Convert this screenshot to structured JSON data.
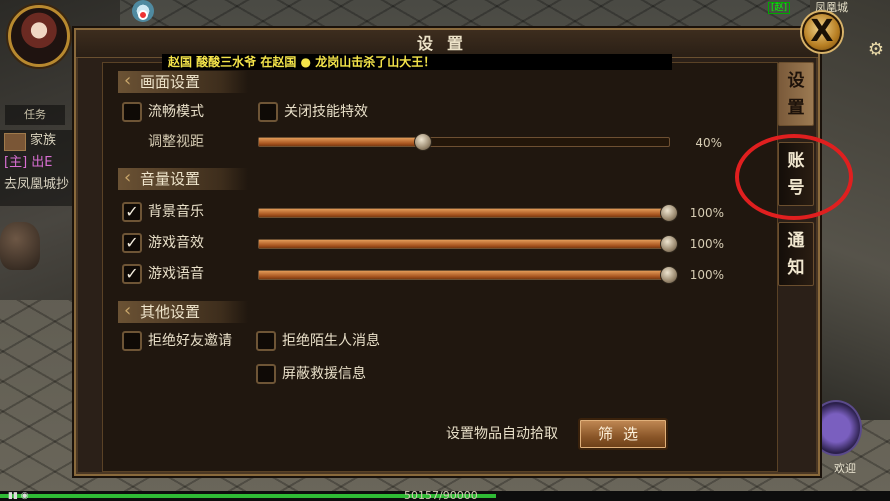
{
  "hud": {
    "task_tab": "任务",
    "chat": {
      "family_label": "家族",
      "main_line": "[主] 出E",
      "system_line": "去凤凰城抄"
    },
    "minimap": {
      "zone_flag": "[赵]",
      "location": "凤凰城"
    },
    "skill_label": "欢迎",
    "exp_text": "50157/90000",
    "exp_progress": 0.557
  },
  "dialog": {
    "title": "设置",
    "marquee": {
      "prefix": "赵国  酸酸三水爷  在赵国",
      "suffix": "龙岗山击杀了山大王！"
    },
    "sections": {
      "graphics": {
        "header": "画面设置",
        "smooth_mode": {
          "label": "流畅模式",
          "checked": false
        },
        "disable_skill_fx": {
          "label": "关闭技能特效",
          "checked": false
        },
        "view_distance": {
          "label": "调整视距",
          "value": 40,
          "display": "40%"
        }
      },
      "sound": {
        "header": "音量设置",
        "bg_music": {
          "label": "背景音乐",
          "checked": true,
          "value": 100,
          "display": "100%"
        },
        "game_sfx": {
          "label": "游戏音效",
          "checked": true,
          "value": 100,
          "display": "100%"
        },
        "game_voice": {
          "label": "游戏语音",
          "checked": true,
          "value": 100,
          "display": "100%"
        }
      },
      "other": {
        "header": "其他设置",
        "reject_friend": {
          "label": "拒绝好友邀请",
          "checked": false
        },
        "reject_stranger": {
          "label": "拒绝陌生人消息",
          "checked": false
        },
        "block_rescue": {
          "label": "屏蔽救援信息",
          "checked": false
        }
      }
    },
    "auto_pickup_label": "设置物品自动拾取",
    "filter_button": "筛选",
    "tabs": [
      {
        "id": "settings",
        "chars": [
          "设",
          "置"
        ],
        "active": true
      },
      {
        "id": "account",
        "chars": [
          "账",
          "号"
        ],
        "active": false,
        "highlighted": true
      },
      {
        "id": "notice",
        "chars": [
          "通",
          "知"
        ],
        "active": false
      }
    ],
    "check_glyph": "✓",
    "close_glyph": "X"
  },
  "colors": {
    "accent_orange": "#c8722d",
    "highlight_red": "#e01f1f",
    "marquee_yellow": "#f4e44a",
    "exp_green": "#2fbb35"
  }
}
